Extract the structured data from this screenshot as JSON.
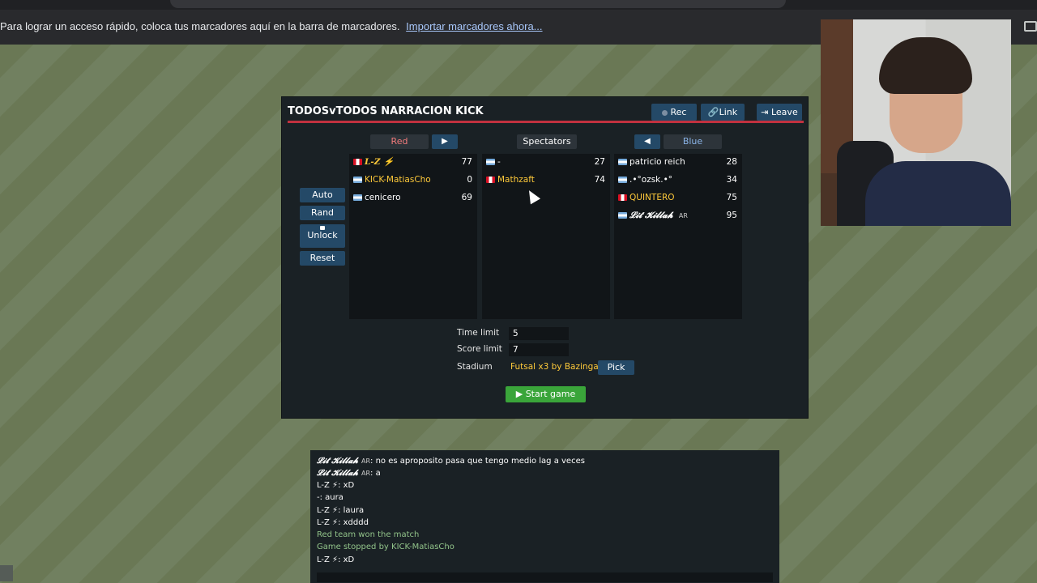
{
  "bookmark_bar": {
    "message": "Para lograr un acceso rápido, coloca tus marcadores aquí en la barra de marcadores.",
    "import_link": "Importar marcadores ahora..."
  },
  "room": {
    "title": "TODOSvTODOS NARRACION KICK",
    "rec_label": "Rec",
    "link_label": "Link",
    "leave_label": "Leave",
    "red_label": "Red",
    "spectators_label": "Spectators",
    "blue_label": "Blue",
    "side_buttons": {
      "auto": "Auto",
      "rand": "Rand",
      "unlock": "Unlock",
      "reset": "Reset"
    },
    "red_players": [
      {
        "name": "L-Z ⚡",
        "score": "77",
        "flag": "pe"
      },
      {
        "name": "KICK-MatiasCho",
        "score": "0",
        "flag": "ar"
      },
      {
        "name": "cenicero",
        "score": "69",
        "flag": "ar"
      }
    ],
    "spectators": [
      {
        "name": "-",
        "score": "27",
        "flag": "ar"
      },
      {
        "name": "Mathzaft",
        "score": "74",
        "flag": "pe"
      }
    ],
    "blue_players": [
      {
        "name": "patricio reich",
        "score": "28",
        "flag": "ar"
      },
      {
        "name": ".•°ozsk.•°",
        "score": "34",
        "flag": "ar"
      },
      {
        "name": "QUINTERO",
        "score": "75",
        "flag": "pe"
      },
      {
        "name": "𝓛𝓲𝓽 𝓚𝓲𝓵𝓵𝓪𝓱",
        "tag": "AR",
        "score": "95",
        "flag": "ar"
      }
    ],
    "settings": {
      "time_limit_label": "Time limit",
      "time_limit_value": "5",
      "score_limit_label": "Score limit",
      "score_limit_value": "7",
      "stadium_label": "Stadium",
      "stadium_value": "Futsal x3 by Bazinga f...",
      "pick_label": "Pick",
      "start_label": "Start game"
    }
  },
  "chat": {
    "lines": [
      {
        "author": "𝓛𝓲𝓽 𝓚𝓲𝓵𝓵𝓪𝓱",
        "tag": "AR",
        "text": ": no es aproposito pasa que tengo medio lag a veces"
      },
      {
        "author": "𝓛𝓲𝓽 𝓚𝓲𝓵𝓵𝓪𝓱",
        "tag": "AR",
        "text": ": a"
      },
      {
        "author": "L-Z ⚡",
        "text": ": xD"
      },
      {
        "author": "-",
        "text": ": aura"
      },
      {
        "author": "L-Z ⚡",
        "text": ": laura"
      },
      {
        "author": "L-Z ⚡",
        "text": ": xdddd"
      },
      {
        "author": "",
        "text": "Red team won the match",
        "system": true
      },
      {
        "author": "",
        "text": "Game stopped by KICK-MatiasCho",
        "system": true
      },
      {
        "author": "L-Z ⚡",
        "text": ": xD"
      }
    ]
  }
}
